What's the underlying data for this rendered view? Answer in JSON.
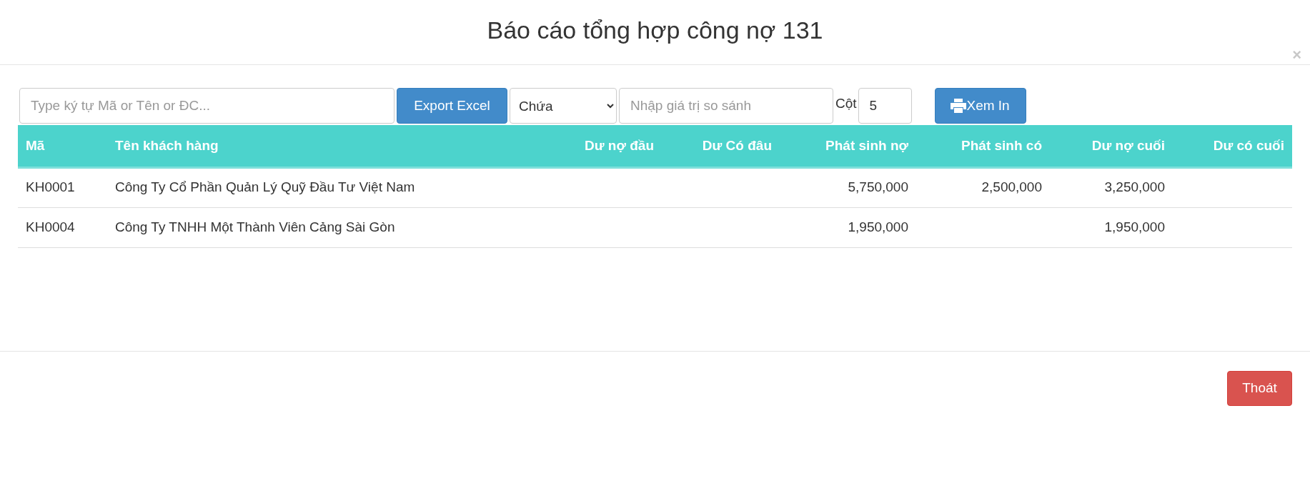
{
  "dialog": {
    "title": "Báo cáo tổng hợp công nợ 131",
    "close": "×"
  },
  "toolbar": {
    "search": {
      "placeholder": "Type ký tự Mã or Tên or ĐC..."
    },
    "export_button": "Export Excel",
    "filter_select": {
      "value": "Chứa"
    },
    "compare_field": {
      "placeholder": "Nhập giá trị so sánh"
    },
    "column_label": "Cột",
    "column_field": {
      "value": "5"
    },
    "print_button": "Xem In"
  },
  "table": {
    "columns": [
      "Mã",
      "Tên khách hàng",
      "Dư nợ đầu",
      "Dư Có đâu",
      "Phát sinh nợ",
      "Phát sinh có",
      "Dư nợ cuối",
      "Dư có cuối"
    ],
    "rows": [
      {
        "cells": [
          "KH0001",
          "Công Ty Cổ Phần Quản Lý Quỹ Đầu Tư Việt Nam",
          null,
          null,
          "5,750,000",
          "2,500,000",
          "3,250,000",
          null
        ]
      },
      {
        "cells": [
          "KH0004",
          "Công Ty TNHH Một Thành Viên Cảng Sài Gòn",
          null,
          null,
          "1,950,000",
          null,
          "1,950,000",
          null
        ]
      }
    ]
  },
  "footer": {
    "exit_button": "Thoát"
  }
}
